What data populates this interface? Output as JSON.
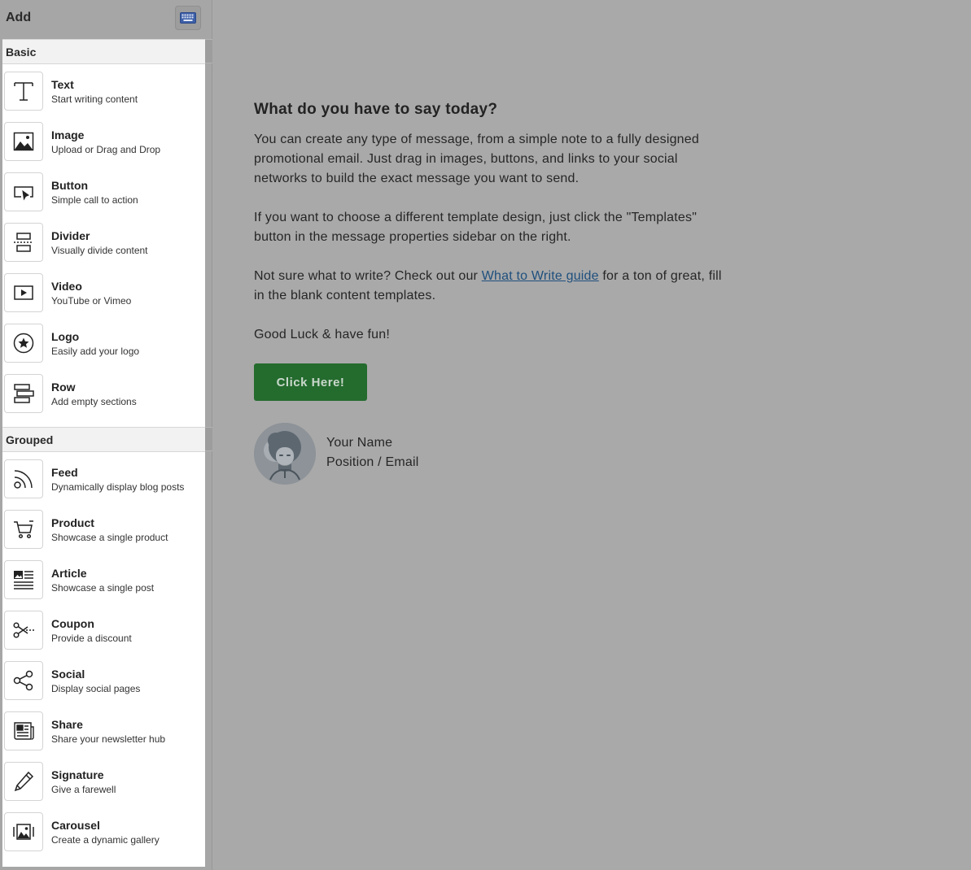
{
  "sidebar": {
    "title": "Add",
    "keyboard_icon": "keyboard-icon",
    "sections": [
      {
        "label": "Basic",
        "items": [
          {
            "label": "Text",
            "desc": "Start writing content",
            "icon": "text-icon"
          },
          {
            "label": "Image",
            "desc": "Upload or Drag and Drop",
            "icon": "image-icon"
          },
          {
            "label": "Button",
            "desc": "Simple call to action",
            "icon": "cursor-icon"
          },
          {
            "label": "Divider",
            "desc": "Visually divide content",
            "icon": "divider-icon"
          },
          {
            "label": "Video",
            "desc": "YouTube or Vimeo",
            "icon": "video-icon"
          },
          {
            "label": "Logo",
            "desc": "Easily add your logo",
            "icon": "star-icon"
          },
          {
            "label": "Row",
            "desc": "Add empty sections",
            "icon": "row-icon"
          }
        ]
      },
      {
        "label": "Grouped",
        "items": [
          {
            "label": "Feed",
            "desc": "Dynamically display blog posts",
            "icon": "rss-icon"
          },
          {
            "label": "Product",
            "desc": "Showcase a single product",
            "icon": "cart-icon"
          },
          {
            "label": "Article",
            "desc": "Showcase a single post",
            "icon": "article-icon"
          },
          {
            "label": "Coupon",
            "desc": "Provide a discount",
            "icon": "scissors-icon"
          },
          {
            "label": "Social",
            "desc": "Display social pages",
            "icon": "share-icon"
          },
          {
            "label": "Share",
            "desc": "Share your newsletter hub",
            "icon": "newspaper-icon"
          },
          {
            "label": "Signature",
            "desc": "Give a farewell",
            "icon": "pencil-icon"
          },
          {
            "label": "Carousel",
            "desc": "Create a dynamic gallery",
            "icon": "gallery-icon"
          }
        ]
      }
    ]
  },
  "message": {
    "headline": "What do you have to say today?",
    "para1": "You can create any type of message, from a simple note to a fully designed promotional email. Just drag in images, buttons, and links to your social networks to build the exact message you want to send.",
    "para2": "If you want to choose a different template design, just click the \"Templates\" button in the message properties sidebar on the right.",
    "para3_before": "Not sure what to write? Check out our ",
    "para3_link": "What to Write guide",
    "para3_after": " for a ton of great, fill in the blank content templates.",
    "para4": "Good Luck & have fun!",
    "cta_label": "Click Here!",
    "signature_name": "Your Name",
    "signature_position": "Position / Email",
    "accent_color": "#246b2e",
    "link_color": "#1e4f7d"
  }
}
